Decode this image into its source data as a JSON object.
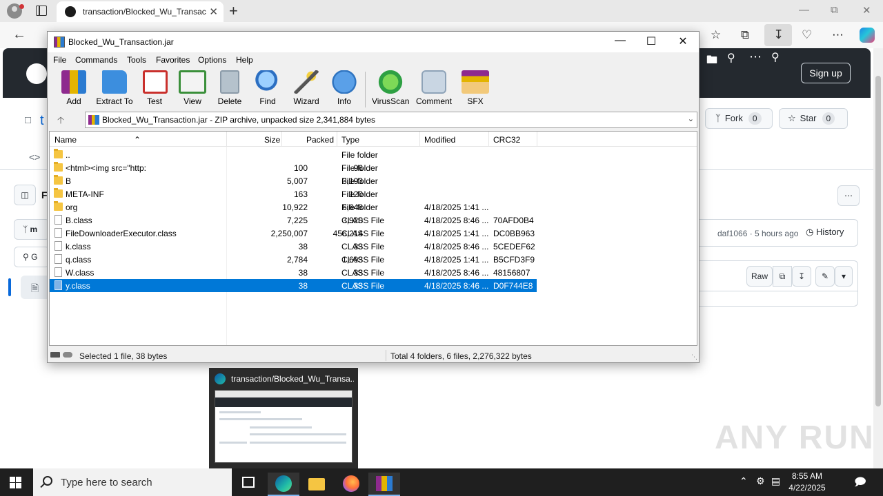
{
  "browser": {
    "tab_title": "transaction/Blocked_Wu_Transac",
    "tab_close": "✕",
    "new_tab": "+"
  },
  "github": {
    "sign_up": "Sign up",
    "fork_label": "Fork",
    "fork_count": "0",
    "star_label": "Star",
    "star_count": "0",
    "commit_author_time": "daf1066 · 5 hours ago",
    "history_label": "History",
    "raw_label": "Raw",
    "partial_letter_t": "t",
    "partial_letter_f": "F",
    "partial_letter_m": "m",
    "partial_letter_g": "G"
  },
  "winrar": {
    "title": "Blocked_Wu_Transaction.jar",
    "menu": [
      "File",
      "Commands",
      "Tools",
      "Favorites",
      "Options",
      "Help"
    ],
    "toolbar": [
      {
        "label": "Add",
        "icon": "add-archive-icon",
        "color": "#b8292f"
      },
      {
        "label": "Extract To",
        "icon": "extract-folder-icon",
        "color": "#3c8ede"
      },
      {
        "label": "Test",
        "icon": "test-clipboard-icon",
        "color": "#c9302c"
      },
      {
        "label": "View",
        "icon": "view-book-icon",
        "color": "#3a8f3a"
      },
      {
        "label": "Delete",
        "icon": "trash-icon",
        "color": "#8a9aa8"
      },
      {
        "label": "Find",
        "icon": "magnifier-icon",
        "color": "#2c6fc2"
      },
      {
        "label": "Wizard",
        "icon": "wand-icon",
        "color": "#7a5fc0"
      },
      {
        "label": "Info",
        "icon": "info-icon",
        "color": "#2f74c0"
      },
      {
        "label": "VirusScan",
        "icon": "bug-icon",
        "color": "#2ea043"
      },
      {
        "label": "Comment",
        "icon": "comment-icon",
        "color": "#8ea3b8"
      },
      {
        "label": "SFX",
        "icon": "sfx-box-icon",
        "color": "#d9822b"
      }
    ],
    "path_text": "Blocked_Wu_Transaction.jar - ZIP archive, unpacked size 2,341,884 bytes",
    "columns": {
      "name": "Name",
      "size": "Size",
      "packed": "Packed",
      "type": "Type",
      "modified": "Modified",
      "crc": "CRC32"
    },
    "rows": [
      {
        "kind": "folder",
        "name": "..",
        "size": "",
        "packed": "",
        "type": "File folder",
        "modified": "",
        "crc": ""
      },
      {
        "kind": "folder",
        "name": "<html><img src=\"http:",
        "size": "100",
        "packed": "96",
        "type": "File folder",
        "modified": "",
        "crc": ""
      },
      {
        "kind": "folder",
        "name": "B",
        "size": "5,007",
        "packed": "3,193",
        "type": "File folder",
        "modified": "",
        "crc": ""
      },
      {
        "kind": "folder",
        "name": "META-INF",
        "size": "163",
        "packed": "120",
        "type": "File folder",
        "modified": "",
        "crc": ""
      },
      {
        "kind": "folder",
        "name": "org",
        "size": "10,922",
        "packed": "6,648",
        "type": "File folder",
        "modified": "4/18/2025 1:41 ...",
        "crc": ""
      },
      {
        "kind": "file",
        "name": "B.class",
        "size": "7,225",
        "packed": "3,920",
        "type": "CLASS File",
        "modified": "4/18/2025 8:46 ...",
        "crc": "70AFD0B4"
      },
      {
        "kind": "file",
        "name": "FileDownloaderExecutor.class",
        "size": "2,250,007",
        "packed": "456,214",
        "type": "CLASS File",
        "modified": "4/18/2025 1:41 ...",
        "crc": "DC0BB963"
      },
      {
        "kind": "file",
        "name": "k.class",
        "size": "38",
        "packed": "33",
        "type": "CLASS File",
        "modified": "4/18/2025 8:46 ...",
        "crc": "5CEDEF62"
      },
      {
        "kind": "file",
        "name": "q.class",
        "size": "2,784",
        "packed": "1,693",
        "type": "CLASS File",
        "modified": "4/18/2025 1:41 ...",
        "crc": "B5CFD3F9"
      },
      {
        "kind": "file",
        "name": "W.class",
        "size": "38",
        "packed": "33",
        "type": "CLASS File",
        "modified": "4/18/2025 8:46 ...",
        "crc": "48156807"
      },
      {
        "kind": "file",
        "name": "y.class",
        "size": "38",
        "packed": "33",
        "type": "CLASS File",
        "modified": "4/18/2025 8:46 ...",
        "crc": "D0F744E8",
        "selected": true
      }
    ],
    "status_left": "Selected 1 file, 38 bytes",
    "status_right": "Total 4 folders, 6 files, 2,276,322 bytes"
  },
  "thumbnail": {
    "title": "transaction/Blocked_Wu_Transa..."
  },
  "watermark": "ANY RUN",
  "taskbar": {
    "search_placeholder": "Type here to search",
    "time": "8:55 AM",
    "date": "4/22/2025"
  }
}
